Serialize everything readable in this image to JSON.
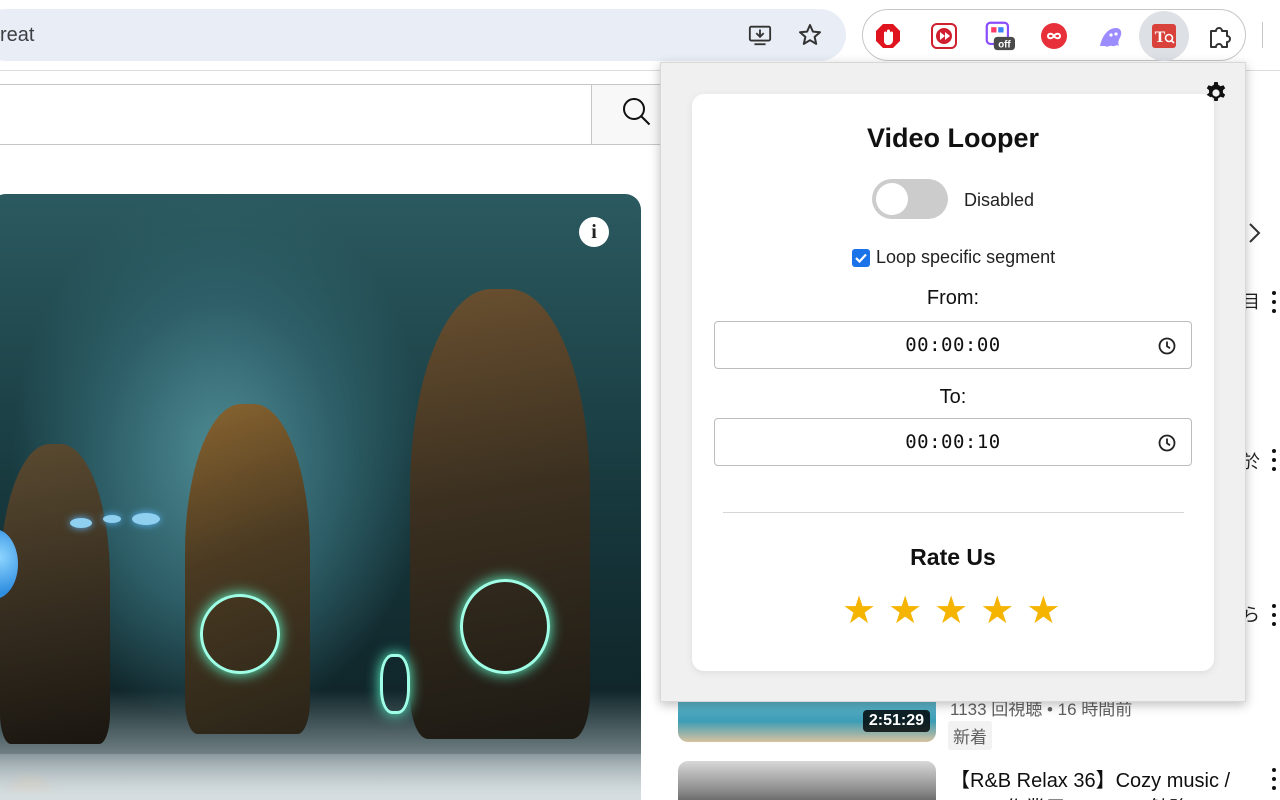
{
  "browser": {
    "address_fragment": "reat",
    "icons": [
      "install-app-icon",
      "bookmark-star-icon",
      "puzzle-extensions-icon"
    ],
    "extensions": [
      {
        "name": "ublock-stop-icon",
        "color": "#e0141e"
      },
      {
        "name": "video-speed-icon",
        "color": "#d02030"
      },
      {
        "name": "tab-manager-off-icon",
        "color": "#8a4cff",
        "badge": "off"
      },
      {
        "name": "infinity-loop-icon",
        "color": "#e8303a"
      },
      {
        "name": "ghost-icon",
        "color": "#9b8cff"
      },
      {
        "name": "video-looper-active-icon",
        "color": "#d9413b"
      }
    ]
  },
  "youtube": {
    "side_fragments": [
      "目",
      "於",
      "ら"
    ],
    "video1": {
      "duration": "2:51:29",
      "meta": "1133 回視聴 • 16 時間前",
      "badge": "新着"
    },
    "video2": {
      "title": "【R&B Relax 36】Cozy music /",
      "title_sub": "Chill | 作業用 / Relax | 勉強"
    }
  },
  "popup": {
    "title": "Video Looper",
    "toggle_label": "Disabled",
    "toggle_on": false,
    "loop_segment_label": "Loop specific segment",
    "loop_segment_checked": true,
    "from_label": "From:",
    "from_value": "00:00:00",
    "to_label": "To:",
    "to_value": "00:00:10",
    "rate_title": "Rate Us",
    "stars": [
      "★",
      "★",
      "★",
      "★",
      "★"
    ],
    "colors": {
      "star": "#f4b400",
      "toggle_off": "#cccccc",
      "checkbox": "#1a73e8"
    }
  }
}
